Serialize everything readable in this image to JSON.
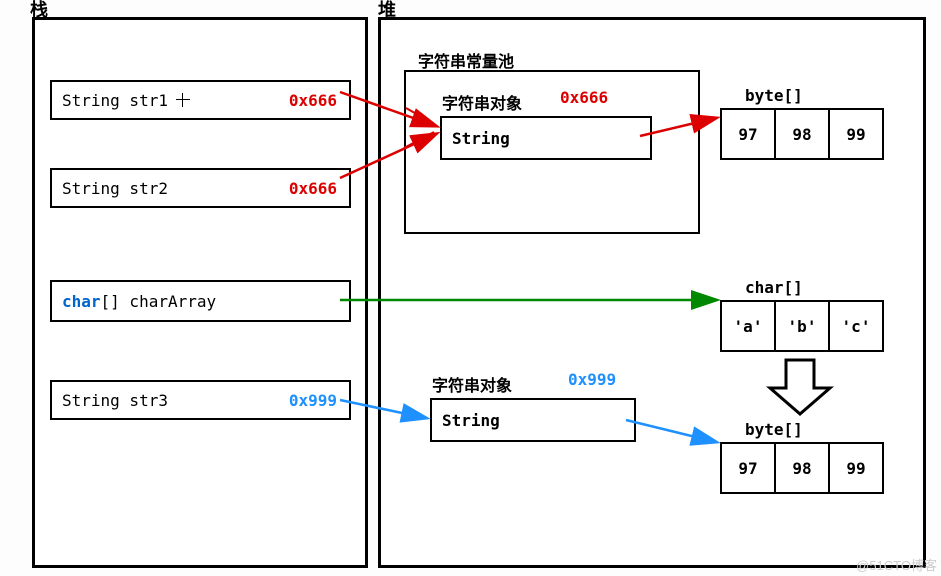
{
  "titles": {
    "stack": "栈",
    "heap": "堆"
  },
  "stack": {
    "str1": {
      "decl": "String str1",
      "addr": "0x666"
    },
    "str2": {
      "decl": "String str2",
      "addr": "0x666"
    },
    "charArray": {
      "kw": "char",
      "rest": "[] charArray"
    },
    "str3": {
      "decl": "String str3",
      "addr": "0x999"
    }
  },
  "heap": {
    "pool": "字符串常量池",
    "obj1": {
      "label": "字符串对象",
      "addr": "0x666",
      "value": "String"
    },
    "obj2": {
      "label": "字符串对象",
      "addr": "0x999",
      "value": "String"
    },
    "byteArr1": {
      "label": "byte[]",
      "cells": [
        "97",
        "98",
        "99"
      ]
    },
    "charArr": {
      "label": "char[]",
      "cells": [
        "'a'",
        "'b'",
        "'c'"
      ]
    },
    "byteArr2": {
      "label": "byte[]",
      "cells": [
        "97",
        "98",
        "99"
      ]
    }
  },
  "watermark": "@51CTO博客"
}
